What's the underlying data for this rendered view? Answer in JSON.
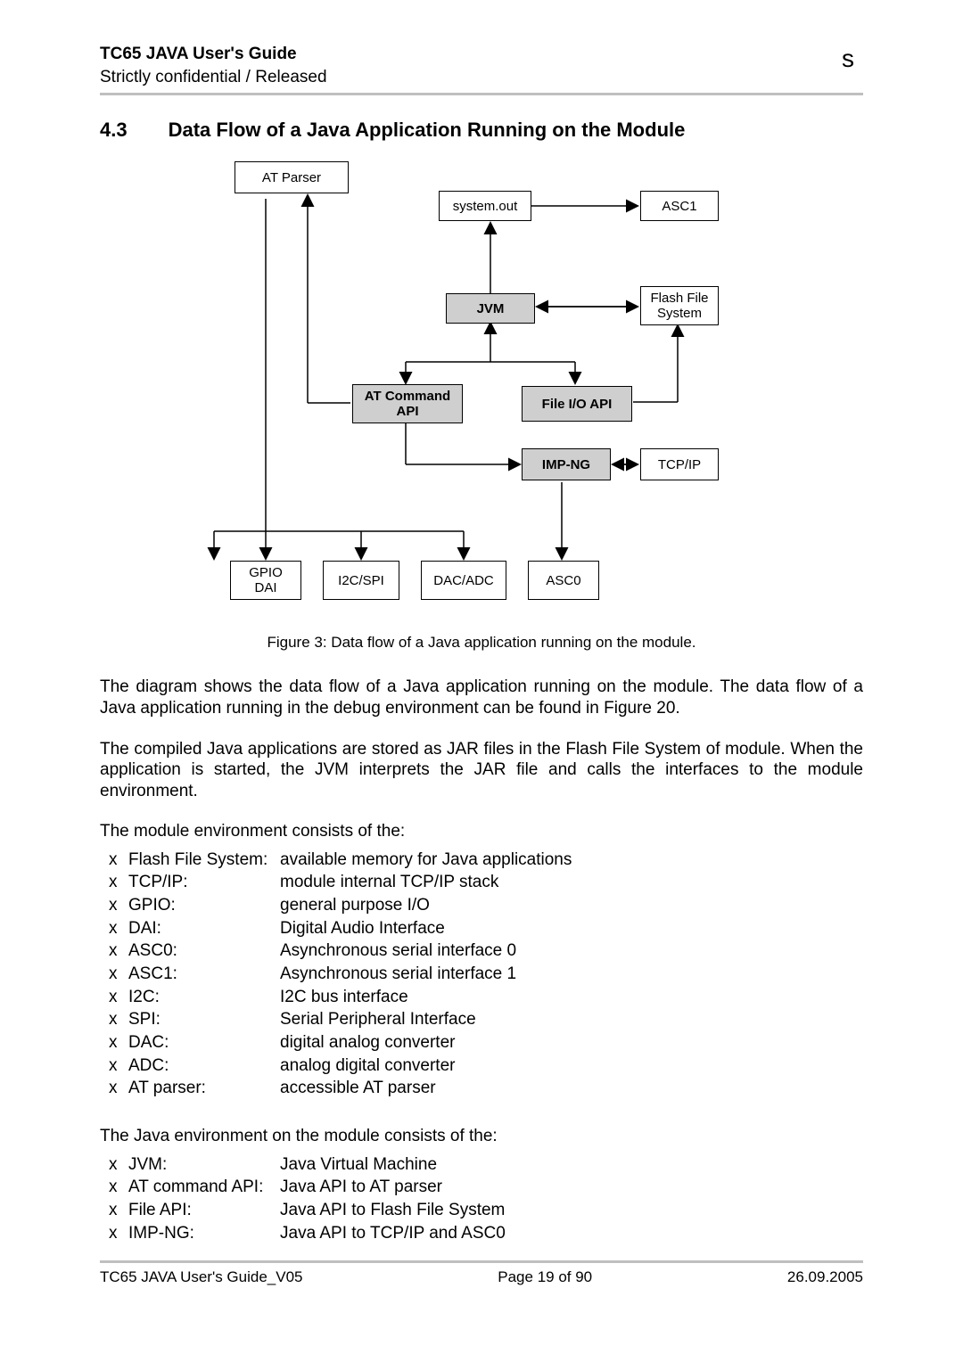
{
  "header": {
    "title": "TC65 JAVA User's Guide",
    "subtitle": "Strictly confidential / Released",
    "mark": "s"
  },
  "section": {
    "number": "4.3",
    "title": "Data Flow of a Java Application Running on the Module"
  },
  "diagram": {
    "boxes": {
      "at_parser": "AT Parser",
      "system_out": "system.out",
      "asc1": "ASC1",
      "jvm": "JVM",
      "ffs": "Flash File\nSystem",
      "at_cmd_api": "AT Command\nAPI",
      "file_io_api": "File I/O API",
      "imp_ng": "IMP-NG",
      "tcpip": "TCP/IP",
      "gpio_dai": "GPIO\nDAI",
      "i2c_spi": "I2C/SPI",
      "dac_adc": "DAC/ADC",
      "asc0": "ASC0"
    },
    "caption": "Figure 3: Data flow of a Java application running on the module."
  },
  "paragraphs": {
    "p1": "The diagram shows the data flow of a Java application running on the module. The data flow of a Java application running in the debug environment can be found in Figure 20.",
    "p2": "The compiled Java applications are stored as JAR files in the Flash File System of module. When the application is started, the JVM interprets the JAR file and calls the interfaces to the module environment.",
    "intro1": "The module environment consists of the:",
    "intro2": "The Java environment on the module consists of the:"
  },
  "module_env": [
    {
      "term": "Flash File System:",
      "desc": "available memory for Java applications"
    },
    {
      "term": "TCP/IP:",
      "desc": "module internal TCP/IP stack"
    },
    {
      "term": "GPIO:",
      "desc": "general purpose I/O"
    },
    {
      "term": "DAI:",
      "desc": "Digital Audio Interface"
    },
    {
      "term": "ASC0:",
      "desc": "Asynchronous serial interface 0"
    },
    {
      "term": "ASC1:",
      "desc": "Asynchronous serial interface 1"
    },
    {
      "term": "I2C:",
      "desc": "I2C bus interface"
    },
    {
      "term": "SPI:",
      "desc": "Serial Peripheral Interface"
    },
    {
      "term": "DAC:",
      "desc": "digital analog converter"
    },
    {
      "term": "ADC:",
      "desc": "analog digital converter"
    },
    {
      "term": "AT parser:",
      "desc": "accessible AT parser"
    }
  ],
  "java_env": [
    {
      "term": "JVM:",
      "desc": "Java Virtual Machine"
    },
    {
      "term": "AT command API:",
      "desc": "Java API to AT parser"
    },
    {
      "term": "File API:",
      "desc": "Java API to Flash File System"
    },
    {
      "term": "IMP-NG:",
      "desc": "Java API to TCP/IP and ASC0"
    }
  ],
  "footer": {
    "left": "TC65 JAVA User's Guide_V05",
    "center": "Page 19 of 90",
    "right": "26.09.2005"
  },
  "bullet": "x"
}
